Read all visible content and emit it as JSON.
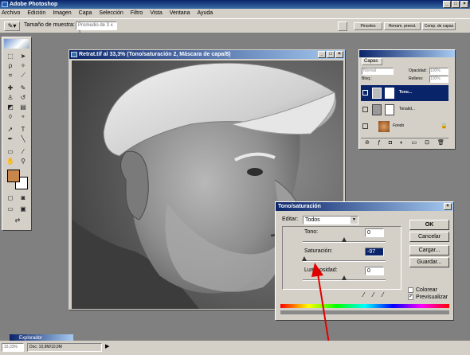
{
  "app": {
    "title": "Adobe Photoshop"
  },
  "menu": [
    "Archivo",
    "Edición",
    "Imagen",
    "Capa",
    "Selección",
    "Filtro",
    "Vista",
    "Ventana",
    "Ayuda"
  ],
  "options": {
    "sample_size_label": "Tamaño de muestra:",
    "sample_size_value": "Promedio de 3 x 3",
    "tabs": [
      "Pinceles",
      "Herram. preest.",
      "Comp. de capas"
    ]
  },
  "document": {
    "title": "Retrat.tif al 33,3% (Tono/saturación 2, Máscara de capa/8)"
  },
  "layers_panel": {
    "tab": "Capas",
    "blend_mode": "Normal",
    "opacity_label": "Opacidad:",
    "opacity_value": "100%",
    "lock_label": "Bloq.:",
    "fill_label": "Relleno:",
    "fill_value": "100%",
    "layers": [
      {
        "name": "Tono...",
        "selected": true
      },
      {
        "name": "Tonalid...",
        "selected": false
      },
      {
        "name": "Fondo",
        "selected": false
      }
    ]
  },
  "dialog": {
    "title": "Tono/saturación",
    "edit_label": "Editar:",
    "edit_value": "Todos",
    "hue_label": "Tono:",
    "hue_value": "0",
    "saturation_label": "Saturación:",
    "saturation_value": "-97",
    "lightness_label": "Luminosidad:",
    "lightness_value": "0",
    "hue_level": 0.5,
    "saturation_level": 0.015,
    "lightness_level": 0.5,
    "ok": "OK",
    "cancel": "Cancelar",
    "load": "Cargar...",
    "save": "Guardar...",
    "colorize": "Colorear",
    "preview": "Previsualizar",
    "colorize_checked": false,
    "preview_checked": true
  },
  "navigator": {
    "title": "Explorador"
  },
  "status": {
    "zoom": "33,33%",
    "doc": "Doc: 10,9M/10,9M"
  },
  "colors": {
    "accent": "#0a246a",
    "arrow": "#e00000",
    "foreground_swatch": "#c8874a"
  }
}
